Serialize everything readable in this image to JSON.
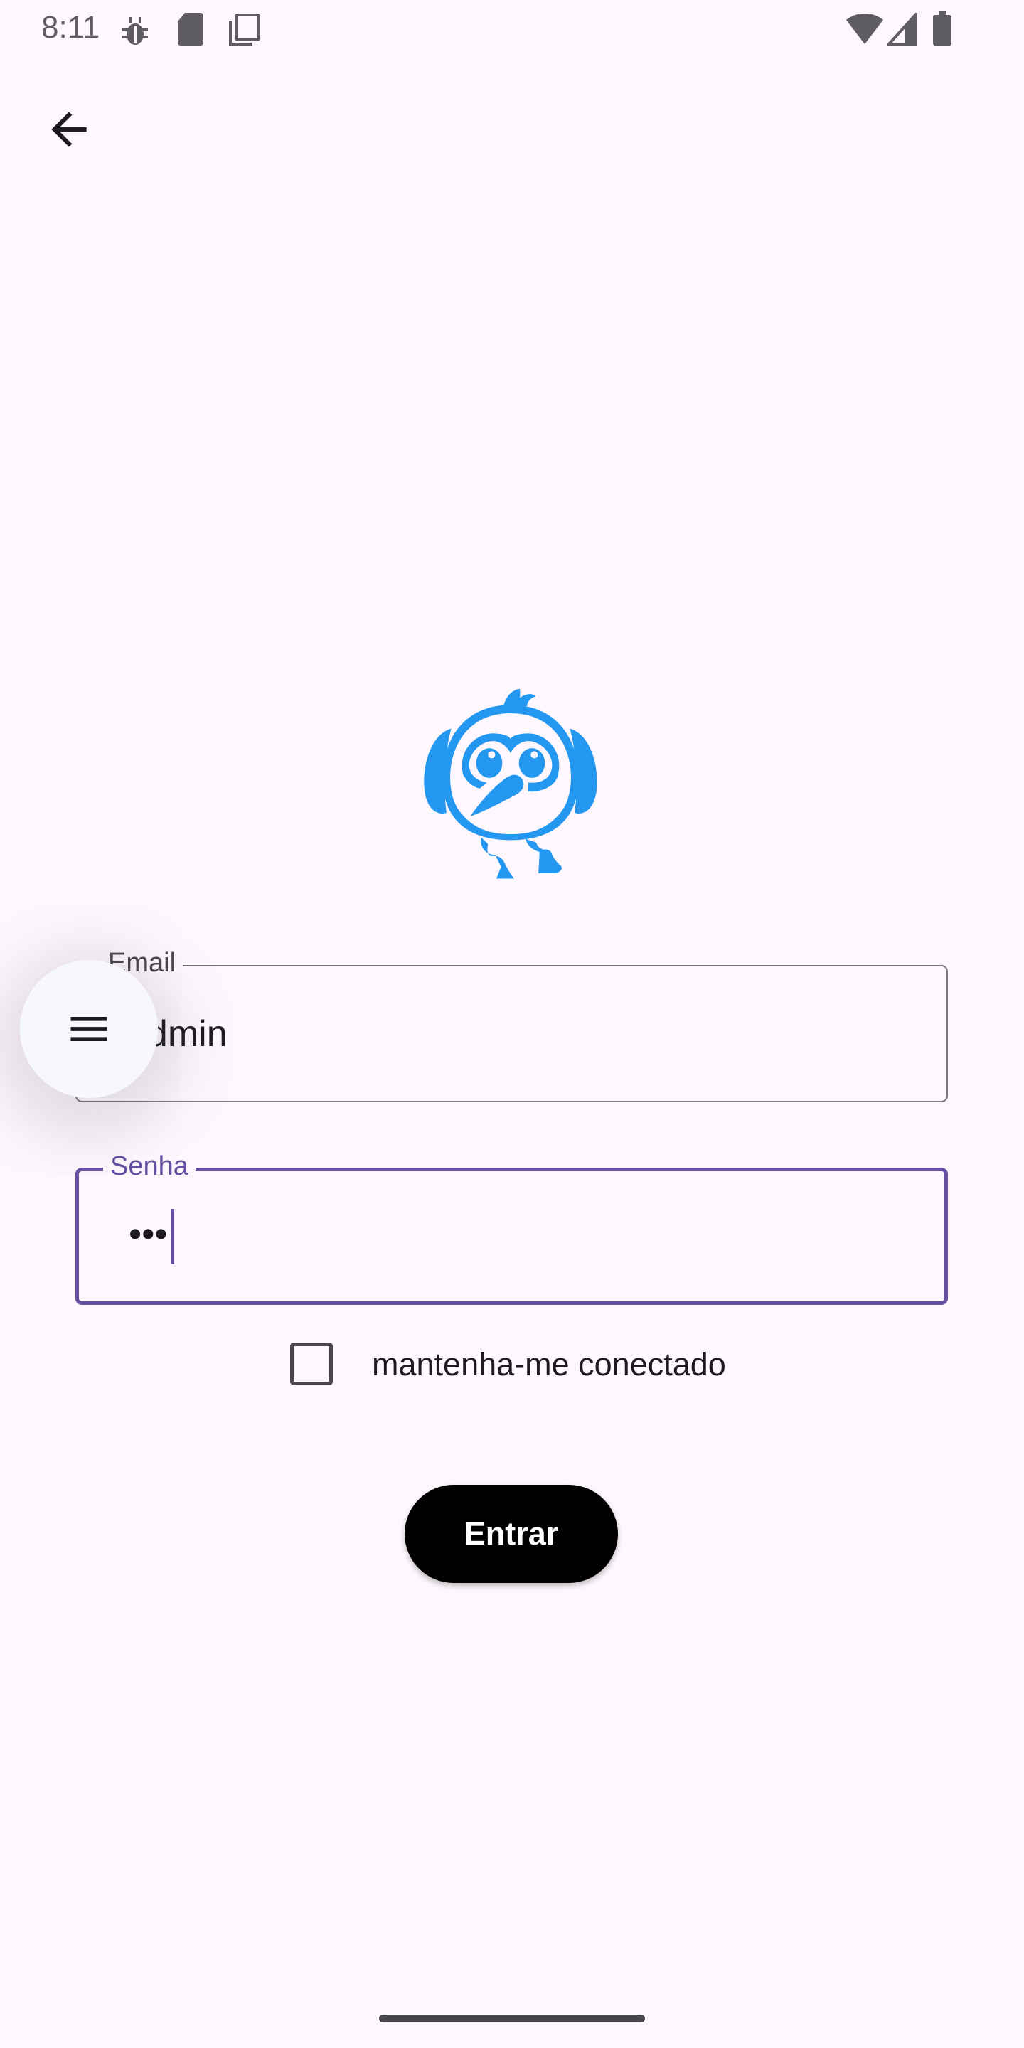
{
  "status_bar": {
    "time": "8:11",
    "icons_left": [
      "bug-icon",
      "sd-card-icon",
      "copy-icon"
    ],
    "icons_right": [
      "wifi-icon",
      "signal-icon",
      "battery-icon"
    ]
  },
  "nav": {
    "back_icon": "arrow-back-icon"
  },
  "form": {
    "email_label": "Email",
    "email_value": "admin",
    "password_label": "Senha",
    "password_value": "•••",
    "remember_label": "mantenha-me conectado",
    "remember_checked": false,
    "submit_label": "Entrar"
  },
  "fab": {
    "icon": "menu-icon"
  },
  "colors": {
    "accent": "#6750a4",
    "logo": "#2497f1",
    "background": "#fef7fd",
    "button": "#000000"
  }
}
